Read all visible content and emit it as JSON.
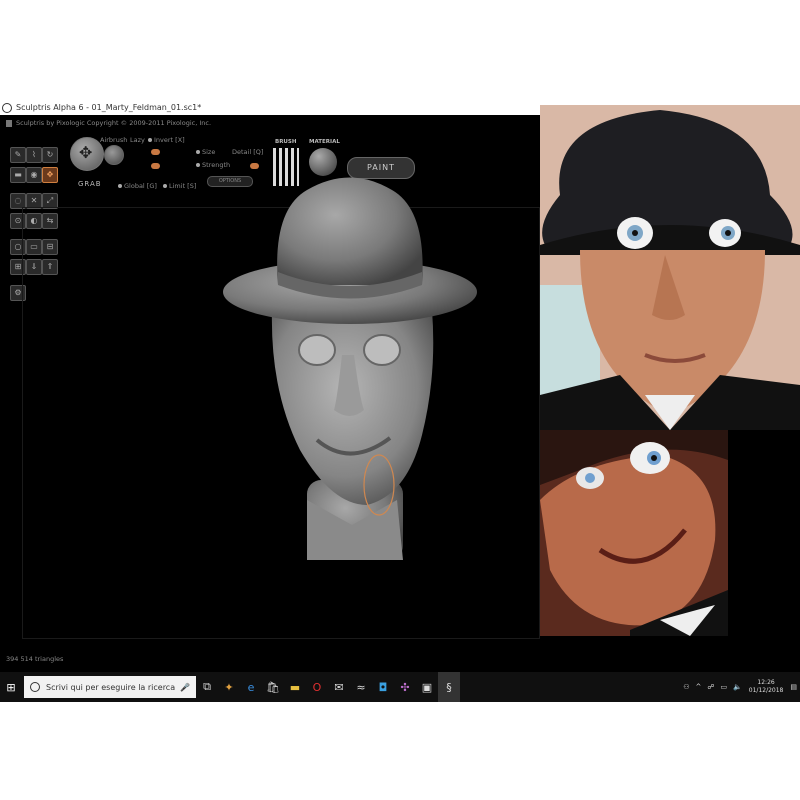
{
  "window": {
    "title": "Sculptris Alpha 6 - 01_Marty_Feldman_01.sc1*"
  },
  "app": {
    "header": "Sculptris by Pixologic  Copyright © 2009-2011 Pixologic, Inc.",
    "brush_label": "BRUSH",
    "material_label": "MATERIAL",
    "paint_label": "PAINT",
    "grab_label": "GRAB",
    "options_label": "OPTIONS",
    "opts": {
      "airbrush": "Airbrush",
      "lazy": "Lazy",
      "invert": "Invert [X]",
      "size": "Size",
      "detail": "Detail [Q]",
      "strength": "Strength",
      "global": "Global [G]",
      "limit": "Limit [S]"
    },
    "triangles": "394 514 triangles"
  },
  "taskbar": {
    "search_placeholder": "Scrivi qui per eseguire la ricerca",
    "time": "12:26",
    "date": "01/12/2018"
  }
}
